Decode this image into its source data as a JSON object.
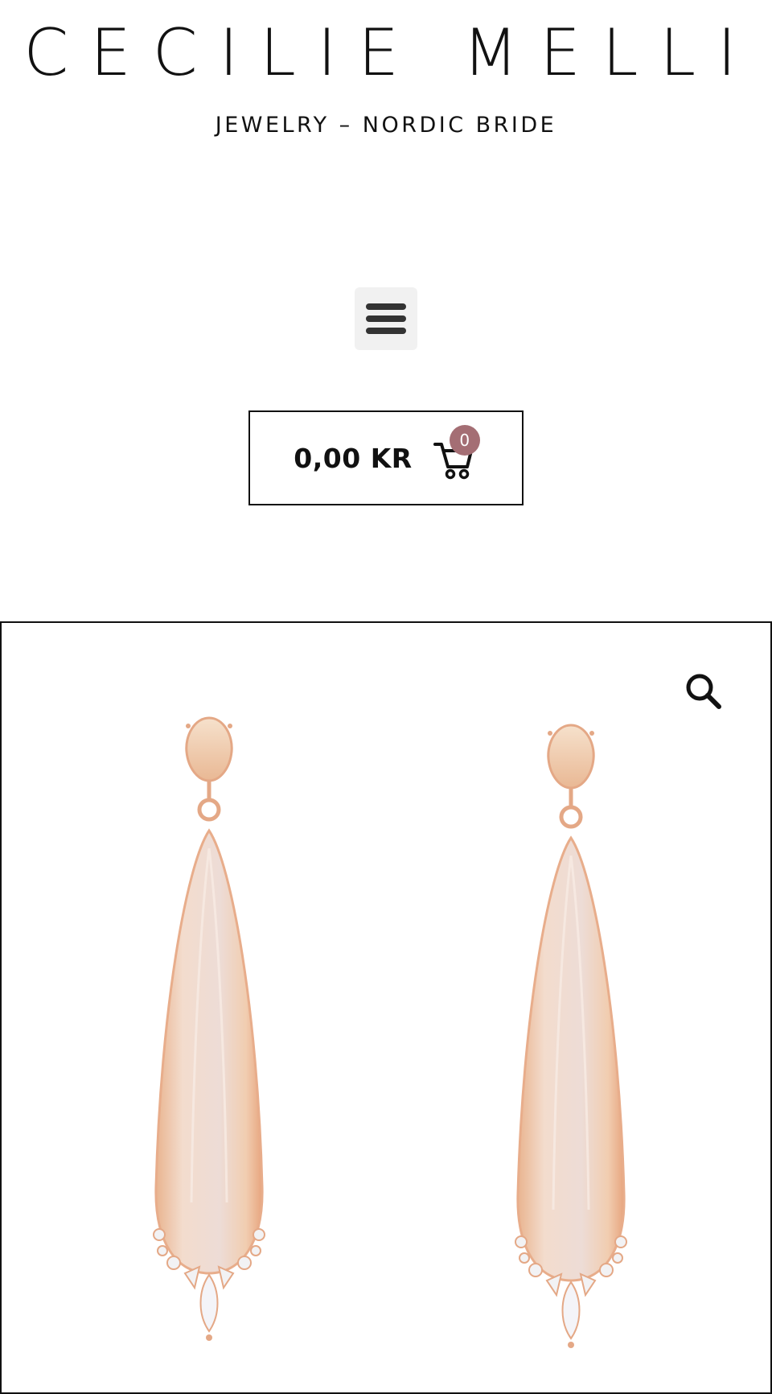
{
  "header": {
    "brand_title": "CECILIE MELLI",
    "tagline": "JEWELRY – NORDIC BRIDE"
  },
  "menu": {
    "icon": "hamburger-menu-icon"
  },
  "cart": {
    "total": "0,00 KR",
    "count": "0",
    "icon": "cart-icon",
    "badge_color": "#a46e74"
  },
  "gallery": {
    "zoom_icon": "search-icon"
  },
  "colors": {
    "text": "#111111",
    "menu_bg": "#f1f1f1",
    "earring_metal": "#e2a58a",
    "earring_stone": "#f3d9c7"
  }
}
